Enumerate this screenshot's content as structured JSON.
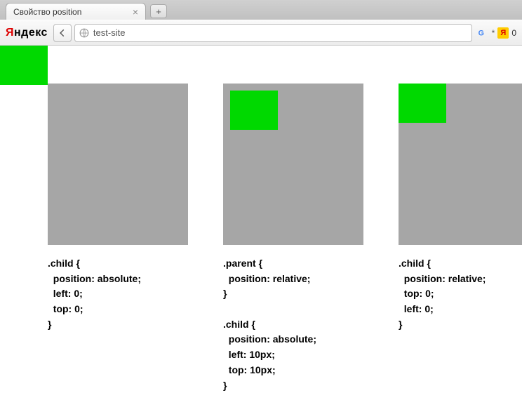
{
  "tab": {
    "title": "Свойство position"
  },
  "brand": {
    "ya": "Я",
    "ndex": "ндекс"
  },
  "address": "test-site",
  "right": {
    "star": "*",
    "zero": "0"
  },
  "examples": {
    "e1": {
      "code": ".child {\n  position: absolute;\n  left: 0;\n  top: 0;\n}"
    },
    "e2": {
      "code": ".parent {\n  position: relative;\n}\n\n.child {\n  position: absolute;\n  left: 10px;\n  top: 10px;\n}"
    },
    "e3": {
      "code": ".child {\n  position: relative;\n  top: 0;\n  left: 0;\n}"
    }
  }
}
